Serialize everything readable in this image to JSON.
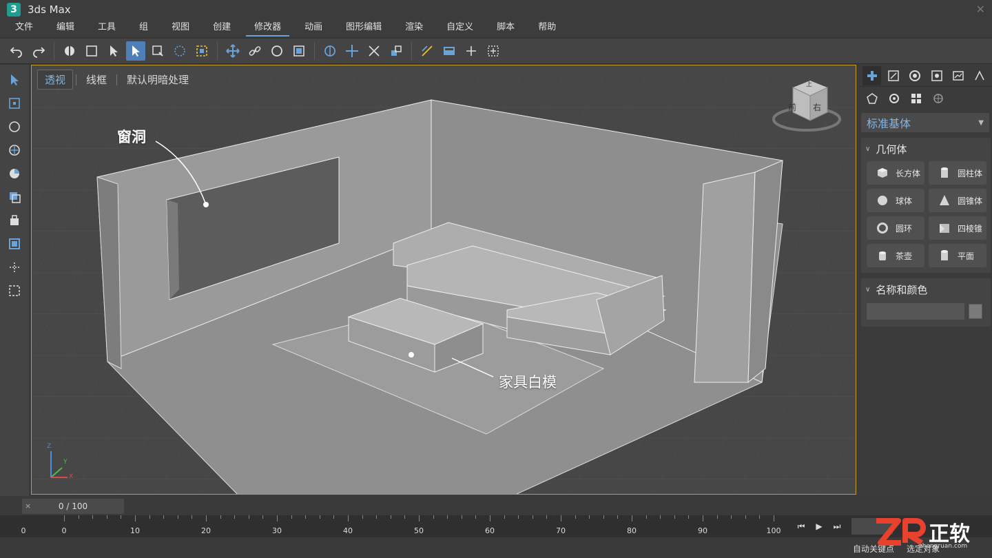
{
  "app": {
    "logo_text": "3",
    "title": "3ds Max"
  },
  "menu": [
    "文件",
    "编辑",
    "工具",
    "组",
    "视图",
    "创建",
    "修改器",
    "动画",
    "图形编辑",
    "渲染",
    "自定义",
    "脚本",
    "帮助"
  ],
  "menu_active_index": 6,
  "toolbar_icons": [
    "undo-icon",
    "redo-icon",
    "link-icon",
    "select-region-icon",
    "select-icon",
    "select-by-name-icon",
    "select-active-icon",
    "region-select-icon",
    "window-crossing-icon",
    "move-icon",
    "rotate-link-icon",
    "rotate-icon",
    "scale-icon",
    "snap-icon",
    "move2-icon",
    "scale2-icon",
    "mirror-icon",
    "align-icon",
    "layer-icon",
    "grid-icon",
    "measure-icon"
  ],
  "viewport": {
    "tabs": [
      "透视",
      "线框",
      "默认明暗处理"
    ],
    "active_tab": 0,
    "viewcube_front": "前",
    "viewcube_right": "右",
    "viewcube_top": "上",
    "annotation_window": "窗洞",
    "annotation_furniture": "家具白模",
    "axis_labels": {
      "z": "Z",
      "y": "Y",
      "x": "X"
    }
  },
  "right_panel": {
    "dropdown_value": "标准基体",
    "section_geometry": "几何体",
    "primitives": [
      {
        "label": "长方体",
        "icon": "box-icon"
      },
      {
        "label": "圆柱体",
        "icon": "cylinder-icon"
      },
      {
        "label": "球体",
        "icon": "sphere-icon"
      },
      {
        "label": "圆锥体",
        "icon": "cone-icon"
      },
      {
        "label": "圆环",
        "icon": "torus-icon"
      },
      {
        "label": "四棱锥",
        "icon": "pyramid-icon"
      },
      {
        "label": "茶壶",
        "icon": "teapot-icon"
      },
      {
        "label": "平面",
        "icon": "plane-icon"
      }
    ],
    "section_name_color": "名称和颜色"
  },
  "timeline": {
    "frame_display": "0 / 100",
    "close_label": "×",
    "ticks": [
      "0",
      "10",
      "20",
      "30",
      "40",
      "50",
      "60",
      "70",
      "80",
      "90",
      "100"
    ],
    "ruler_left_label": "0"
  },
  "status": {
    "auto_key": "自动关键点",
    "set_key": "选定对象"
  },
  "watermark": {
    "brand": "正软",
    "site": "zhengruan.com"
  }
}
